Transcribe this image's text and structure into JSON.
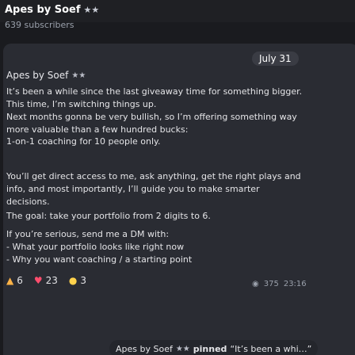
{
  "header": {
    "channel_name": "Apes by Soef",
    "channel_emoji": "★★",
    "subscribers": "639 subscribers"
  },
  "post": {
    "date": "July 31",
    "author_name": "Apes by Soef",
    "author_emoji": "★★",
    "lines_1": [
      "It’s been a while since the last giveaway time for something bigger.",
      "This time, I’m switching things up.",
      "Next months gonna be very bullish, so I’m offering something way",
      "more valuable than a few hundred bucks:"
    ],
    "line_2": "1-on-1 coaching for 10 people only.",
    "lines_3": [
      "You’ll get direct access to me, ask anything, get the right plays and",
      "info, and most importantly, I’ll guide you to make smarter",
      "decisions."
    ],
    "line_4": "The goal: take your portfolio from 2 digits to 6.",
    "lines_5": [
      "If you’re serious, send me a DM with:",
      "- What your portfolio looks like right now",
      "- Why you want coaching / a starting point"
    ],
    "reactions": [
      {
        "icon": "fire",
        "count": "6"
      },
      {
        "icon": "heart",
        "count": "23"
      },
      {
        "icon": "bulb",
        "count": "3"
      }
    ],
    "views": "375",
    "time": "23:16"
  },
  "pinned": {
    "author": "Apes by Soef",
    "author_emoji": "★★",
    "text_bold": "pinned",
    "text_rest": "“It’s been a whi…”"
  },
  "colors": {
    "background": "#1a1b1f",
    "card": "#2a2c33",
    "accent_fire": "#ffb347",
    "accent_heart": "#ff4d6d",
    "accent_bulb": "#ffd24c"
  }
}
